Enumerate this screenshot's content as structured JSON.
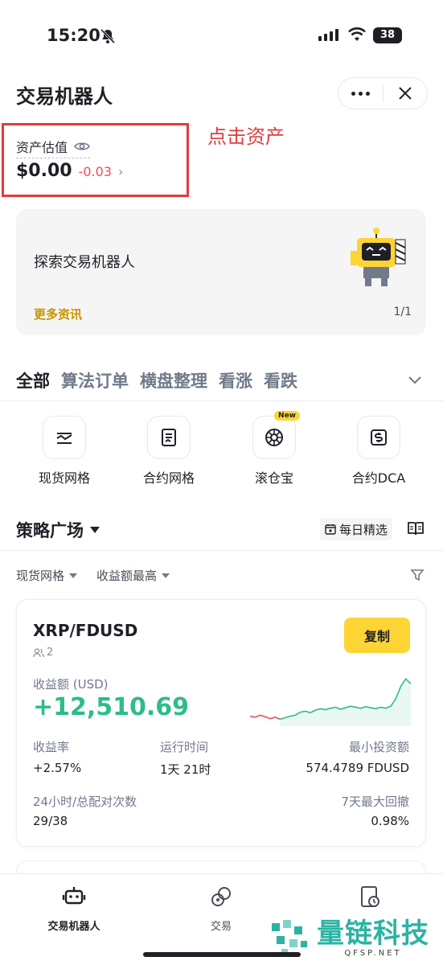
{
  "status_bar": {
    "time": "15:20",
    "battery": "38"
  },
  "header": {
    "title": "交易机器人"
  },
  "assets": {
    "label": "资产估值",
    "value": "$0.00",
    "change": "-0.03",
    "annotation": "点击资产"
  },
  "banner": {
    "title": "探索交易机器人",
    "link": "更多资讯",
    "pager": "1/1"
  },
  "categories": [
    {
      "label": "全部",
      "active": true
    },
    {
      "label": "算法订单",
      "active": false
    },
    {
      "label": "横盘整理",
      "active": false
    },
    {
      "label": "看涨",
      "active": false
    },
    {
      "label": "看跌",
      "active": false
    }
  ],
  "strategies": [
    {
      "label": "现货网格",
      "icon": "spot-grid-icon"
    },
    {
      "label": "合约网格",
      "icon": "futures-grid-icon"
    },
    {
      "label": "滚仓宝",
      "icon": "rolling-icon",
      "badge": "New"
    },
    {
      "label": "合约DCA",
      "icon": "futures-dca-icon"
    }
  ],
  "plaza": {
    "title": "策略广场",
    "daily_pick": "每日精选",
    "filters": [
      "现货网格",
      "收益额最高"
    ]
  },
  "card": {
    "pair": "XRP/FDUSD",
    "copiers": "2",
    "copy_label": "复制",
    "pnl_label": "收益额 (USD)",
    "pnl_value": "+12,510.69",
    "roi_label": "收益率",
    "roi_value": "+2.57%",
    "runtime_label": "运行时间",
    "runtime_value": "1天 21时",
    "min_invest_label": "最小投资额",
    "min_invest_value": "574.4789 FDUSD",
    "matches_label": "24小时/总配对次数",
    "matches_value": "29/38",
    "drawdown_label": "7天最大回撤",
    "drawdown_value": "0.98%",
    "sparkline": [
      0.2,
      0.18,
      0.22,
      0.19,
      0.15,
      0.18,
      0.14,
      0.17,
      0.2,
      0.22,
      0.28,
      0.3,
      0.27,
      0.32,
      0.35,
      0.33,
      0.36,
      0.38,
      0.34,
      0.37,
      0.4,
      0.38,
      0.36,
      0.39,
      0.37,
      0.35,
      0.38,
      0.36,
      0.4,
      0.55,
      0.8,
      0.95,
      0.85
    ]
  },
  "bottom_nav": [
    {
      "label": "交易机器人",
      "active": true
    },
    {
      "label": "交易",
      "active": false
    },
    {
      "label": "",
      "active": false
    }
  ],
  "watermark": {
    "main": "量链科技",
    "sub": "QFSP.NET"
  },
  "colors": {
    "accent": "#fcd535",
    "positive": "#2ebd85",
    "negative": "#f6465d",
    "annotation": "#e23b3b"
  }
}
